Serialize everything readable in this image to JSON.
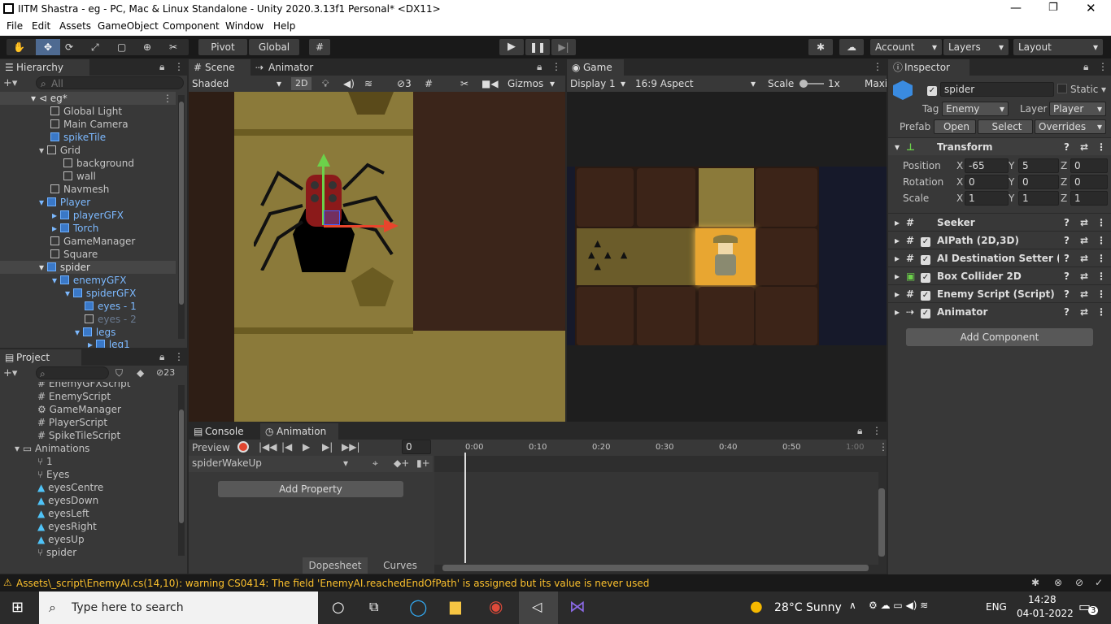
{
  "window": {
    "title": "IITM Shastra - eg - PC, Mac & Linux Standalone - Unity 2020.3.13f1 Personal* <DX11>"
  },
  "menu": [
    "File",
    "Edit",
    "Assets",
    "GameObject",
    "Component",
    "Window",
    "Help"
  ],
  "toolbar": {
    "pivot": "Pivot",
    "global": "Global",
    "account": "Account",
    "layers": "Layers",
    "layout": "Layout"
  },
  "hierarchy": {
    "tab": "Hierarchy",
    "search_placeholder": "All",
    "items": [
      {
        "label": "eg*",
        "blue": false
      },
      {
        "label": "Global Light"
      },
      {
        "label": "Main Camera"
      },
      {
        "label": "spikeTile",
        "blue": true
      },
      {
        "label": "Grid"
      },
      {
        "label": "background"
      },
      {
        "label": "wall"
      },
      {
        "label": "Navmesh"
      },
      {
        "label": "Player",
        "blue": true
      },
      {
        "label": "playerGFX",
        "blue": true
      },
      {
        "label": "Torch",
        "blue": true
      },
      {
        "label": "GameManager"
      },
      {
        "label": "Square"
      },
      {
        "label": "spider",
        "blue": true
      },
      {
        "label": "enemyGFX",
        "blue": true
      },
      {
        "label": "spiderGFX",
        "blue": true
      },
      {
        "label": "eyes - 1",
        "blue": true
      },
      {
        "label": "eyes - 2",
        "dim": true
      },
      {
        "label": "legs",
        "blue": true
      },
      {
        "label": "leg1",
        "blue": true
      }
    ]
  },
  "project": {
    "tab": "Project",
    "count": "23",
    "items": [
      "EnemyGFXScript",
      "EnemyScript",
      "GameManager",
      "PlayerScript",
      "SpikeTileScript",
      "Animations",
      "1",
      "Eyes",
      "eyesCentre",
      "eyesDown",
      "eyesLeft",
      "eyesRight",
      "eyesUp",
      "spider"
    ]
  },
  "scene": {
    "tab": "Scene",
    "tab2": "Animator",
    "shading": "Shaded",
    "mode2d": "2D",
    "hidden_count": "3",
    "gizmos": "Gizmos"
  },
  "game": {
    "tab": "Game",
    "display": "Display 1",
    "aspect": "16:9 Aspect",
    "scale_label": "Scale",
    "scale_value": "1x",
    "maxi": "Maxi"
  },
  "inspector": {
    "tab": "Inspector",
    "name": "spider",
    "static": "Static",
    "tag_label": "Tag",
    "tag": "Enemy",
    "layer_label": "Layer",
    "layer": "Player",
    "prefab_label": "Prefab",
    "open": "Open",
    "select": "Select",
    "overrides": "Overrides",
    "transform": "Transform",
    "position": {
      "label": "Position",
      "x": "-65",
      "y": "5",
      "z": "0"
    },
    "rotation": {
      "label": "Rotation",
      "x": "0",
      "y": "0",
      "z": "0"
    },
    "scale": {
      "label": "Scale",
      "x": "1",
      "y": "1",
      "z": "1"
    },
    "components": [
      "Seeker",
      "AIPath (2D,3D)",
      "AI Destination Setter (Scr",
      "Box Collider 2D",
      "Enemy Script (Script)",
      "Animator"
    ],
    "add_component": "Add Component"
  },
  "console": {
    "tab": "Console"
  },
  "animation": {
    "tab": "Animation",
    "preview": "Preview",
    "frame": "0",
    "clip": "spiderWakeUp",
    "add_property": "Add Property",
    "dopesheet": "Dopesheet",
    "curves": "Curves",
    "ticks": [
      "0:00",
      "0:10",
      "0:20",
      "0:30",
      "0:40",
      "0:50",
      "1:00"
    ]
  },
  "status": {
    "message": "Assets\\_script\\EnemyAI.cs(14,10): warning CS0414: The field 'EnemyAI.reachedEndOfPath' is assigned but its value is never used"
  },
  "taskbar": {
    "search": "Type here to search",
    "weather": "28°C  Sunny",
    "lang": "ENG",
    "time": "14:28",
    "date": "04-01-2022",
    "notif": "3"
  }
}
